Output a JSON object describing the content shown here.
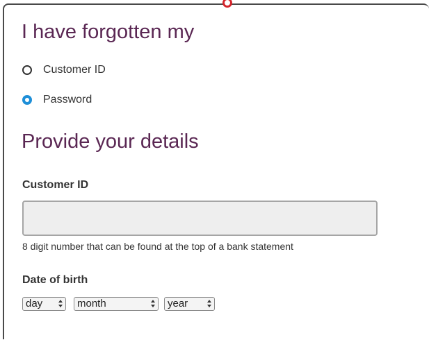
{
  "recovery": {
    "forgotten_heading": "I have forgotten my",
    "options": [
      {
        "label": "Customer ID",
        "selected": false
      },
      {
        "label": "Password",
        "selected": true
      }
    ]
  },
  "details": {
    "heading": "Provide your details",
    "customer_id": {
      "label": "Customer ID",
      "value": "",
      "hint": "8 digit number that can be found at the top of a bank statement"
    },
    "date_of_birth": {
      "label": "Date of birth",
      "day": "day",
      "month": "month",
      "year": "year"
    }
  },
  "colors": {
    "heading": "#5a2753",
    "radio_selected": "#1e8fd8",
    "brand_ring": "#d4252c"
  }
}
